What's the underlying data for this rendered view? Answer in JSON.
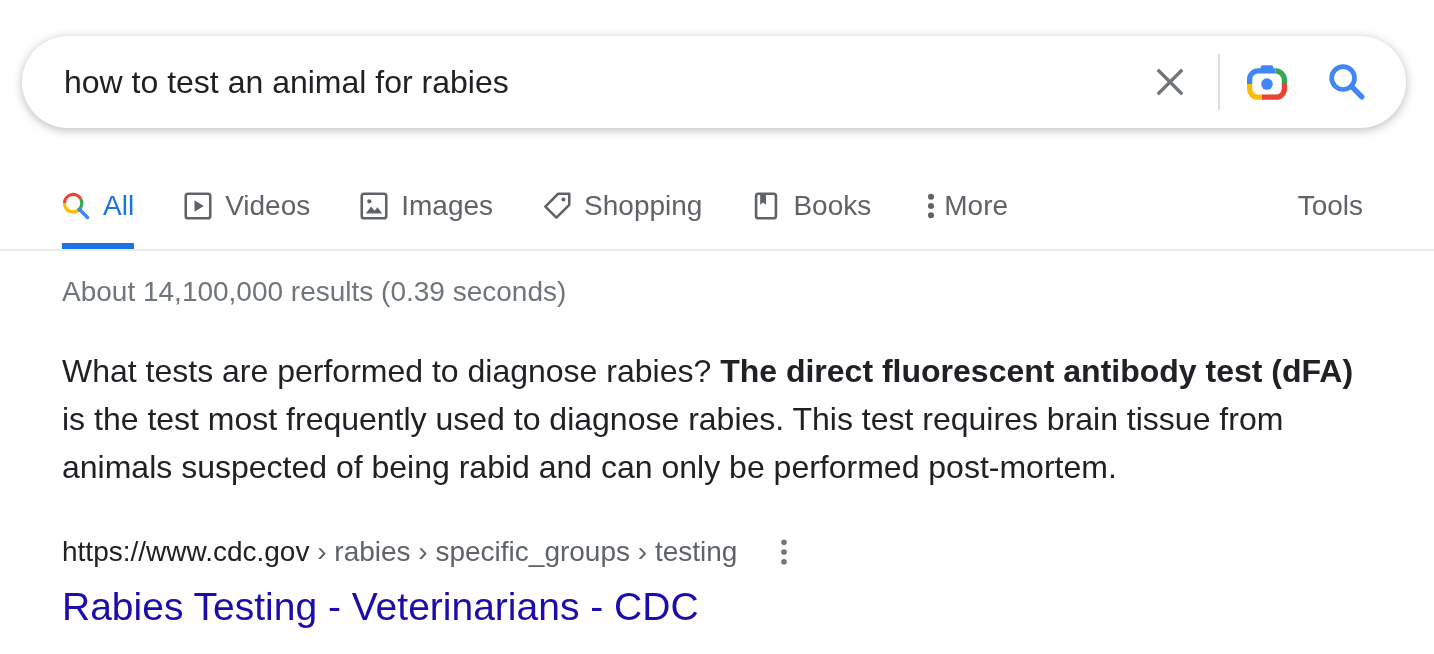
{
  "search": {
    "query": "how to test an animal for rabies"
  },
  "tabs": [
    {
      "kind": "all",
      "label": "All",
      "selected": true
    },
    {
      "kind": "videos",
      "label": "Videos",
      "selected": false
    },
    {
      "kind": "images",
      "label": "Images",
      "selected": false
    },
    {
      "kind": "shopping",
      "label": "Shopping",
      "selected": false
    },
    {
      "kind": "books",
      "label": "Books",
      "selected": false
    },
    {
      "kind": "more",
      "label": "More",
      "selected": false
    }
  ],
  "tools": "Tools",
  "result_stats": "About 14,100,000 results (0.39 seconds)",
  "featured_snippet": "What tests are performed to diagnose rabies? **The direct fluorescent antibody test (dFA)** is the test most frequently used to diagnose rabies. This test requires brain tissue from animals suspected of being rabid and can only be performed post-mortem.",
  "result": {
    "url_host": "https://www.cdc.gov",
    "url_path": "› rabies › specific_groups › testing",
    "title": "Rabies Testing - Veterinarians - CDC"
  }
}
